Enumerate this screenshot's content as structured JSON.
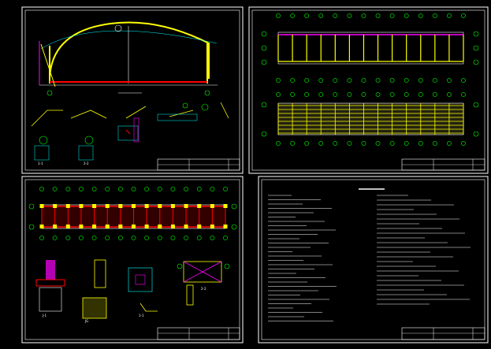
{
  "sheets": [
    {
      "id": "sheet-elevation",
      "name": ""
    },
    {
      "id": "sheet-plans",
      "name": ""
    },
    {
      "id": "sheet-foundation",
      "name": ""
    },
    {
      "id": "sheet-notes",
      "name": ""
    }
  ],
  "labels": {
    "detail_1_1": "1-1",
    "detail_2_2": "2-2",
    "detail_j1": "J-1",
    "detail_jg": "JG",
    "section_11": "1-1",
    "section_22": "2-2"
  },
  "colors": {
    "background": "#000000",
    "frame": "#ffffff",
    "roof": "#ffff00",
    "column": "#ffff00",
    "beam": "#ff0000",
    "accent": "#ff00ff",
    "axis_bubble": "#00ff00",
    "dimension": "#00ffff"
  }
}
